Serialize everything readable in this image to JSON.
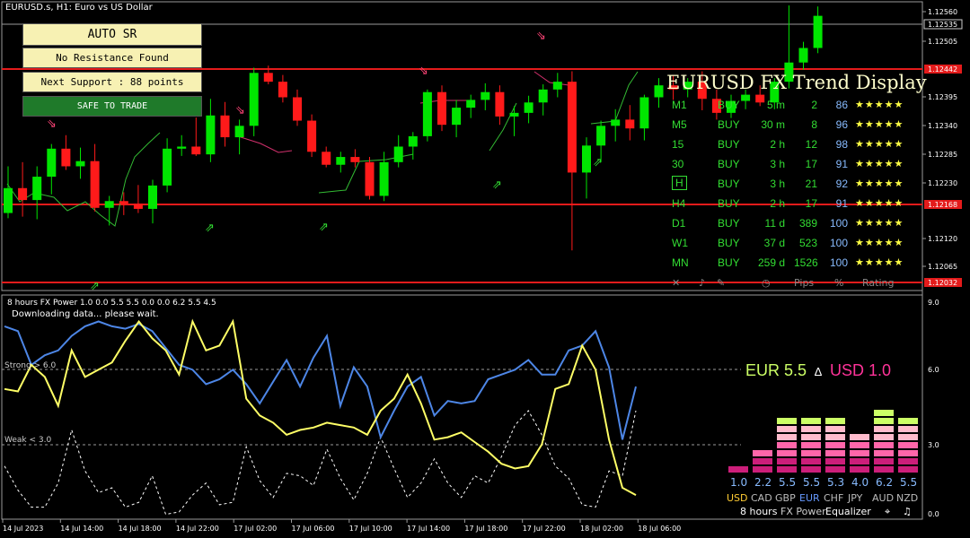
{
  "symbol_title": "EURUSD.s, H1:  Euro vs US Dollar",
  "auto_sr": {
    "title": "AUTO  SR",
    "resistance": "No Resistance Found",
    "support": "Next Support : 88 points",
    "status": "SAFE TO TRADE"
  },
  "price_axis": {
    "labels": [
      "1.12560",
      "1.12505",
      "1.12395",
      "1.12340",
      "1.12285",
      "1.12230",
      "1.12120",
      "1.12065"
    ],
    "tags": [
      "1.12535",
      "1.12442",
      "1.12168",
      "1.12032"
    ]
  },
  "trend_display": {
    "title": "EURUSD FX Trend Display",
    "rows": [
      {
        "tf": "M1",
        "dir": "BUY",
        "dur": "5 m",
        "pips": "2",
        "pct": "86",
        "stars": "★★★★★"
      },
      {
        "tf": "M5",
        "dir": "BUY",
        "dur": "30 m",
        "pips": "8",
        "pct": "96",
        "stars": "★★★★★"
      },
      {
        "tf": "15",
        "dir": "BUY",
        "dur": "2 h",
        "pips": "12",
        "pct": "98",
        "stars": "★★★★★"
      },
      {
        "tf": "30",
        "dir": "BUY",
        "dur": "3 h",
        "pips": "17",
        "pct": "91",
        "stars": "★★★★★"
      },
      {
        "tf": "H",
        "dir": "BUY",
        "dur": "3 h",
        "pips": "21",
        "pct": "92",
        "stars": "★★★★★"
      },
      {
        "tf": "H4",
        "dir": "BUY",
        "dur": "2 h",
        "pips": "17",
        "pct": "91",
        "stars": "★★★★★"
      },
      {
        "tf": "D1",
        "dir": "BUY",
        "dur": "11 d",
        "pips": "389",
        "pct": "100",
        "stars": "★★★★★"
      },
      {
        "tf": "W1",
        "dir": "BUY",
        "dur": "37 d",
        "pips": "523",
        "pct": "100",
        "stars": "★★★★★"
      },
      {
        "tf": "MN",
        "dir": "BUY",
        "dur": "259 d",
        "pips": "1526",
        "pct": "100",
        "stars": "★★★★★"
      }
    ],
    "footer": {
      "pips": "Pips",
      "percent": "%",
      "rating": "Rating"
    }
  },
  "sub_window": {
    "title": "8 hours FX Power 1.0 0.0 5.5 5.5 0.0 0.0 6.2 5.5 4.5",
    "status": "Downloading data... please wait.",
    "strong_label": "Strong > 6.0",
    "weak_label": "Weak < 3.0",
    "axis": [
      "9.0",
      "6.0",
      "3.0",
      "0.0"
    ]
  },
  "fx_power": {
    "base": "EUR 5.5",
    "quote": "USD 1.0",
    "delta_symbol": "∆",
    "currencies": [
      "USD",
      "CAD",
      "GBP",
      "EUR",
      "CHF",
      "JPY",
      "AUD",
      "NZD"
    ],
    "values": [
      "1.0",
      "2.2",
      "5.5",
      "5.5",
      "5.3",
      "4.0",
      "6.2",
      "5.5"
    ],
    "footer": {
      "hours": "8 hours",
      "power": "FX Power",
      "equalizer": "Equalizer"
    }
  },
  "time_axis": [
    "14 Jul 2023",
    "14 Jul 14:00",
    "14 Jul 18:00",
    "14 Jul 22:00",
    "17 Jul 02:00",
    "17 Jul 06:00",
    "17 Jul 10:00",
    "17 Jul 14:00",
    "17 Jul 18:00",
    "17 Jul 22:00",
    "18 Jul 02:00",
    "18 Jul 06:00"
  ],
  "colors": {
    "bull": "#00e600",
    "bear": "#ff1a1a",
    "sr_line": "#e41b1b",
    "eur": "#ffff66",
    "usd": "#4d86e6",
    "trend_green": "#33dd33",
    "title_cream": "#ffffcc",
    "panel_yellow": "#f7f1b3",
    "safe_green": "#1f7a2a"
  },
  "candles": [
    [
      1.12172,
      1.12262,
      1.12162,
      1.1222
    ],
    [
      1.1222,
      1.1227,
      1.12165,
      1.12197
    ],
    [
      1.12197,
      1.12262,
      1.1216,
      1.12242
    ],
    [
      1.12242,
      1.12305,
      1.12208,
      1.12296
    ],
    [
      1.12296,
      1.12322,
      1.12255,
      1.12262
    ],
    [
      1.12262,
      1.12298,
      1.12238,
      1.12272
    ],
    [
      1.12272,
      1.12305,
      1.12175,
      1.12182
    ],
    [
      1.12182,
      1.12205,
      1.12148,
      1.12195
    ],
    [
      1.12195,
      1.12212,
      1.12168,
      1.1219
    ],
    [
      1.1219,
      1.12226,
      1.12172,
      1.1218
    ],
    [
      1.1218,
      1.12236,
      1.12152,
      1.12225
    ],
    [
      1.12225,
      1.12316,
      1.12212,
      1.12296
    ],
    [
      1.12296,
      1.12322,
      1.12282,
      1.123
    ],
    [
      1.123,
      1.12356,
      1.12282,
      1.12285
    ],
    [
      1.12285,
      1.12392,
      1.1227,
      1.1236
    ],
    [
      1.1236,
      1.12386,
      1.123,
      1.12318
    ],
    [
      1.12318,
      1.12352,
      1.12285,
      1.1234
    ],
    [
      1.1234,
      1.12452,
      1.1232,
      1.12442
    ],
    [
      1.12442,
      1.12456,
      1.1242,
      1.12425
    ],
    [
      1.12425,
      1.12438,
      1.12385,
      1.12395
    ],
    [
      1.12395,
      1.1241,
      1.1234,
      1.1235
    ],
    [
      1.1235,
      1.12362,
      1.1228,
      1.1229
    ],
    [
      1.1229,
      1.123,
      1.1226,
      1.12265
    ],
    [
      1.12265,
      1.1229,
      1.1225,
      1.1228
    ],
    [
      1.1228,
      1.12295,
      1.1226,
      1.1227
    ],
    [
      1.1227,
      1.1228,
      1.12198,
      1.12205
    ],
    [
      1.12205,
      1.1229,
      1.12195,
      1.1227
    ],
    [
      1.1227,
      1.12322,
      1.1226,
      1.123
    ],
    [
      1.123,
      1.12328,
      1.12275,
      1.1232
    ],
    [
      1.1232,
      1.1241,
      1.1231,
      1.12405
    ],
    [
      1.12405,
      1.12418,
      1.1233,
      1.12342
    ],
    [
      1.12342,
      1.1239,
      1.12318,
      1.12375
    ],
    [
      1.12375,
      1.124,
      1.12355,
      1.1239
    ],
    [
      1.1239,
      1.12422,
      1.1237,
      1.12405
    ],
    [
      1.12405,
      1.12418,
      1.12342,
      1.12358
    ],
    [
      1.12358,
      1.12378,
      1.1232,
      1.12365
    ],
    [
      1.12365,
      1.12398,
      1.12345,
      1.12385
    ],
    [
      1.12385,
      1.1242,
      1.1236,
      1.1241
    ],
    [
      1.1241,
      1.12442,
      1.12395,
      1.12425
    ],
    [
      1.12425,
      1.12445,
      1.121,
      1.1225
    ],
    [
      1.1225,
      1.12318,
      1.122,
      1.12302
    ],
    [
      1.12302,
      1.1235,
      1.1227,
      1.1234
    ],
    [
      1.1234,
      1.12372,
      1.1231,
      1.12352
    ],
    [
      1.12352,
      1.1238,
      1.12312,
      1.12335
    ],
    [
      1.12335,
      1.124,
      1.12312,
      1.12395
    ],
    [
      1.12395,
      1.12432,
      1.12375,
      1.12418
    ],
    [
      1.12418,
      1.12438,
      1.1239,
      1.1241
    ],
    [
      1.1241,
      1.12432,
      1.12395,
      1.12425
    ],
    [
      1.12425,
      1.12445,
      1.1237,
      1.12392
    ],
    [
      1.12392,
      1.1241,
      1.12352,
      1.12365
    ],
    [
      1.12365,
      1.124,
      1.12355,
      1.12388
    ],
    [
      1.12388,
      1.1241,
      1.12372,
      1.124
    ],
    [
      1.124,
      1.12418,
      1.12378,
      1.12385
    ],
    [
      1.12385,
      1.12432,
      1.12372,
      1.12425
    ],
    [
      1.12425,
      1.12572,
      1.12412,
      1.12462
    ],
    [
      1.12462,
      1.12502,
      1.12448,
      1.1249
    ],
    [
      1.1249,
      1.1257,
      1.1248,
      1.12552
    ]
  ],
  "eur_line": [
    5.4,
    5.3,
    6.4,
    5.9,
    4.7,
    7.0,
    5.9,
    6.2,
    6.5,
    7.4,
    8.2,
    7.5,
    7.0,
    6.0,
    8.2,
    7.0,
    7.2,
    8.2,
    5.0,
    4.3,
    4.0,
    3.5,
    3.7,
    3.8,
    4.0,
    3.9,
    3.8,
    3.5,
    4.5,
    5.0,
    6.0,
    4.8,
    3.3,
    3.4,
    3.6,
    3.2,
    2.8,
    2.3,
    2.1,
    2.2,
    3.1,
    5.4,
    5.6,
    7.2,
    6.2,
    3.3,
    1.3,
    1.0
  ],
  "usd_line": [
    8.0,
    7.8,
    6.4,
    6.8,
    7.0,
    7.6,
    8.0,
    8.2,
    8.0,
    7.9,
    8.1,
    7.8,
    7.1,
    6.4,
    6.2,
    5.6,
    5.8,
    6.2,
    5.6,
    4.8,
    5.7,
    6.6,
    5.5,
    6.7,
    7.6,
    4.7,
    6.3,
    5.5,
    3.4,
    4.5,
    5.5,
    5.9,
    4.3,
    4.9,
    4.8,
    4.9,
    5.8,
    6.0,
    6.2,
    6.6,
    6.0,
    6.0,
    7.0,
    7.2,
    7.8,
    6.3,
    3.3,
    5.5
  ],
  "dash_line": [
    2.2,
    1.2,
    0.5,
    0.5,
    1.5,
    3.7,
    2.0,
    1.1,
    1.3,
    0.5,
    0.7,
    1.8,
    0.2,
    0.3,
    1.0,
    1.5,
    0.6,
    0.7,
    3.0,
    1.6,
    0.9,
    1.9,
    1.8,
    1.4,
    2.9,
    1.7,
    0.8,
    1.9,
    3.4,
    2.1,
    0.9,
    1.5,
    2.5,
    1.5,
    0.9,
    1.8,
    1.5,
    2.6,
    3.9,
    4.5,
    3.5,
    2.2,
    1.7,
    0.6,
    0.5,
    2.0,
    1.8,
    4.5
  ]
}
